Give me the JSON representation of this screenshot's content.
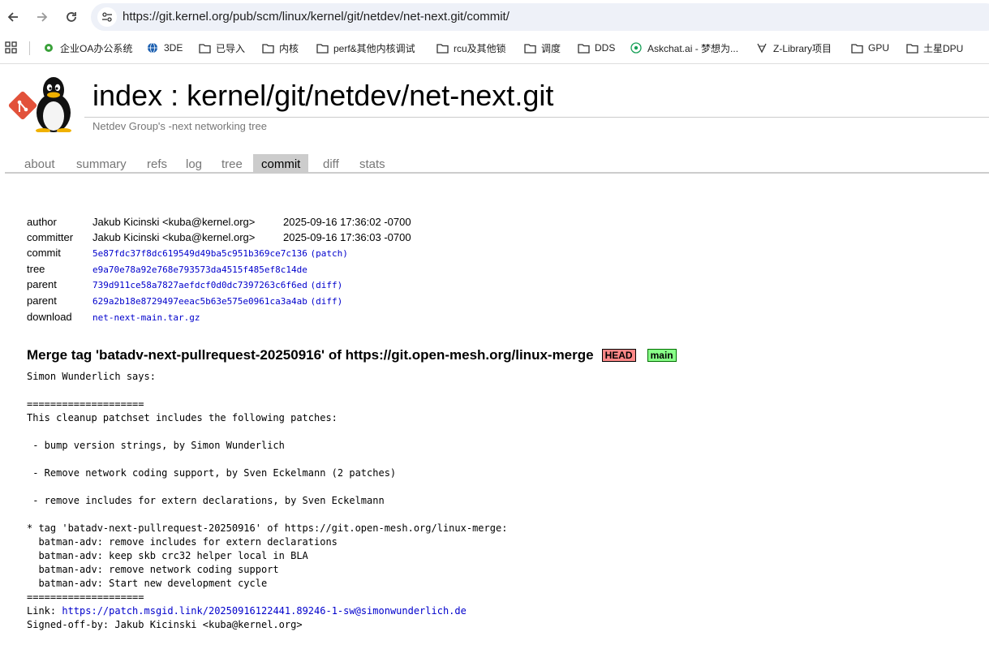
{
  "browser": {
    "url": "https://git.kernel.org/pub/scm/linux/kernel/git/netdev/net-next.git/commit/",
    "bookmarks": [
      {
        "label": "企业OA办公系统",
        "icon": "gear-flower-icon"
      },
      {
        "label": "3DE",
        "icon": "globe-icon"
      },
      {
        "label": "已导入",
        "icon": "folder-icon"
      },
      {
        "label": "内核",
        "icon": "folder-icon"
      },
      {
        "label": "perf&其他内核调试",
        "icon": "folder-icon"
      },
      {
        "label": "rcu及其他锁",
        "icon": "folder-icon"
      },
      {
        "label": "调度",
        "icon": "folder-icon"
      },
      {
        "label": "DDS",
        "icon": "folder-icon"
      },
      {
        "label": "Askchat.ai - 梦想为...",
        "icon": "askchat-icon"
      },
      {
        "label": "Z-Library项目",
        "icon": "zlib-icon"
      },
      {
        "label": "GPU",
        "icon": "folder-icon"
      },
      {
        "label": "土星DPU",
        "icon": "folder-icon"
      }
    ]
  },
  "repo": {
    "title": "index : kernel/git/netdev/net-next.git",
    "description": "Netdev Group's -next networking tree"
  },
  "tabs": [
    {
      "label": "about"
    },
    {
      "label": "summary"
    },
    {
      "label": "refs"
    },
    {
      "label": "log"
    },
    {
      "label": "tree"
    },
    {
      "label": "commit",
      "active": true
    },
    {
      "label": "diff"
    },
    {
      "label": "stats"
    }
  ],
  "commit_info": {
    "author_label": "author",
    "author": "Jakub Kicinski <kuba@kernel.org>",
    "author_date": "2025-09-16 17:36:02 -0700",
    "committer_label": "committer",
    "committer": "Jakub Kicinski <kuba@kernel.org>",
    "committer_date": "2025-09-16 17:36:03 -0700",
    "commit_label": "commit",
    "commit": "5e87fdc37f8dc619549d49ba5c951b369ce7c136",
    "commit_action": "(patch)",
    "tree_label": "tree",
    "tree": "e9a70e78a92e768e793573da4515f485ef8c14de",
    "parent_label": "parent",
    "parent1": "739d911ce58a7827aefdcf0d0dc7397263c6f6ed",
    "parent1_action": "(diff)",
    "parent2": "629a2b18e8729497eeac5b63e575e0961ca3a4ab",
    "parent2_action": "(diff)",
    "download_label": "download",
    "download": "net-next-main.tar.gz"
  },
  "subject": {
    "text": "Merge tag 'batadv-next-pullrequest-20250916' of https://git.open-mesh.org/linux-merge",
    "decorations": [
      "HEAD",
      "main"
    ]
  },
  "message": {
    "body": "Simon Wunderlich says:\n\n====================\nThis cleanup patchset includes the following patches:\n\n - bump version strings, by Simon Wunderlich\n\n - Remove network coding support, by Sven Eckelmann (2 patches)\n\n - remove includes for extern declarations, by Sven Eckelmann\n\n* tag 'batadv-next-pullrequest-20250916' of https://git.open-mesh.org/linux-merge:\n  batman-adv: remove includes for extern declarations\n  batman-adv: keep skb crc32 helper local in BLA\n  batman-adv: remove network coding support\n  batman-adv: Start new development cycle\n====================\n",
    "link_label": "Link: ",
    "link_url": "https://patch.msgid.link/20250916122441.89246-1-sw@simonwunderlich.de",
    "signoff": "Signed-off-by: Jakub Kicinski <kuba@kernel.org>"
  }
}
